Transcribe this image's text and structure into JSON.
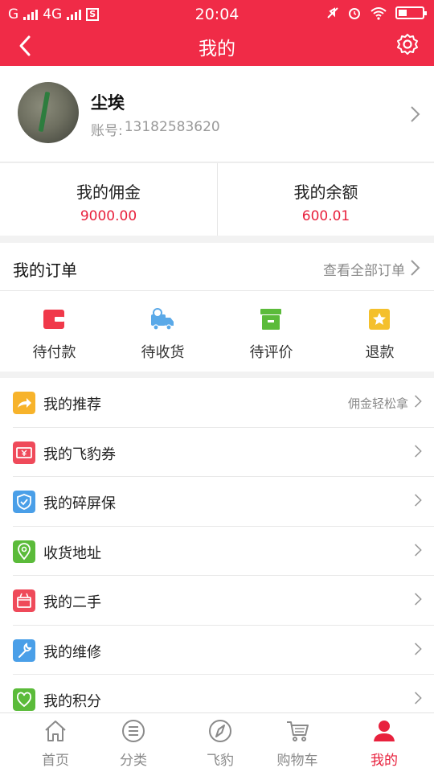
{
  "status_bar": {
    "carrier": "G",
    "network": "4G",
    "time": "20:04"
  },
  "header": {
    "title": "我的"
  },
  "profile": {
    "name": "尘埃",
    "account_label": "账号:",
    "account_number": "13182583620"
  },
  "balances": [
    {
      "label": "我的佣金",
      "value": "9000.00"
    },
    {
      "label": "我的余额",
      "value": "600.01"
    }
  ],
  "orders": {
    "title": "我的订单",
    "view_all": "查看全部订单",
    "statuses": [
      {
        "label": "待付款",
        "icon": "wallet-icon",
        "color": "#f0394a"
      },
      {
        "label": "待收货",
        "icon": "delivery-truck-icon",
        "color": "#5aa9e8"
      },
      {
        "label": "待评价",
        "icon": "archive-box-icon",
        "color": "#5bbb3a"
      },
      {
        "label": "退款",
        "icon": "star-badge-icon",
        "color": "#f4c02c"
      }
    ]
  },
  "menu": [
    {
      "label": "我的推荐",
      "right": "佣金轻松拿",
      "icon": "share-arrow-icon",
      "color": "#f7b32b"
    },
    {
      "label": "我的飞豹券",
      "right": "",
      "icon": "coupon-icon",
      "color": "#ef4a5a"
    },
    {
      "label": "我的碎屏保",
      "right": "",
      "icon": "shield-icon",
      "color": "#4a9fe8"
    },
    {
      "label": "收货地址",
      "right": "",
      "icon": "location-pin-icon",
      "color": "#5bbb3a"
    },
    {
      "label": "我的二手",
      "right": "",
      "icon": "basket-icon",
      "color": "#ef4a5a"
    },
    {
      "label": "我的维修",
      "right": "",
      "icon": "wrench-icon",
      "color": "#4a9fe8"
    },
    {
      "label": "我的积分",
      "right": "",
      "icon": "heart-icon",
      "color": "#5bbb3a"
    }
  ],
  "bottom_nav": [
    {
      "label": "首页",
      "icon": "home-icon"
    },
    {
      "label": "分类",
      "icon": "list-icon"
    },
    {
      "label": "飞豹",
      "icon": "compass-icon"
    },
    {
      "label": "购物车",
      "icon": "cart-icon"
    },
    {
      "label": "我的",
      "icon": "user-icon",
      "active": true
    }
  ],
  "colors": {
    "brand": "#f02b47",
    "accent_text": "#e8213d",
    "inactive": "#8a8a8a"
  }
}
